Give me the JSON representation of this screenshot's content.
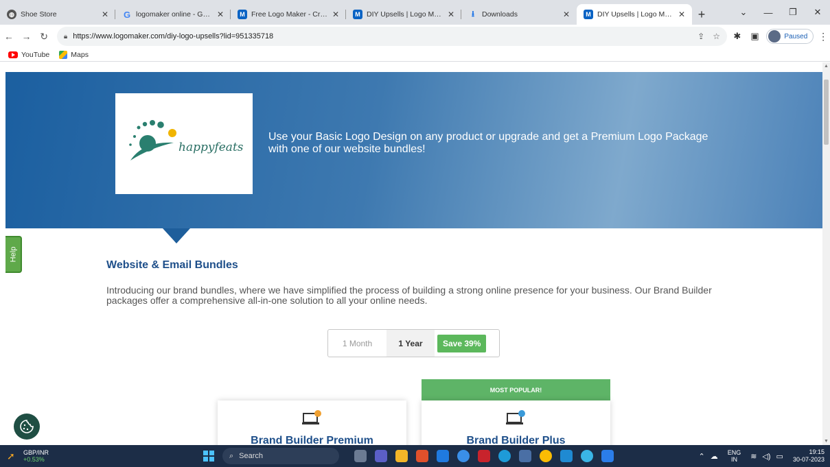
{
  "browser": {
    "tabs": [
      {
        "title": "Shoe Store",
        "icon": "globe-icon",
        "active": false
      },
      {
        "title": "logomaker online - Google",
        "icon": "google-icon",
        "active": false
      },
      {
        "title": "Free Logo Maker - Create a",
        "icon": "logomaker-icon",
        "active": false
      },
      {
        "title": "DIY Upsells | Logo Maker",
        "icon": "logomaker-icon",
        "active": false
      },
      {
        "title": "Downloads",
        "icon": "download-icon",
        "active": false
      },
      {
        "title": "DIY Upsells | Logo Maker",
        "icon": "logomaker-icon",
        "active": true
      }
    ],
    "url": "https://www.logomaker.com/diy-logo-upsells?lid=951335718",
    "profile_label": "Paused",
    "bookmarks": [
      {
        "label": "YouTube",
        "icon": "youtube-icon"
      },
      {
        "label": "Maps",
        "icon": "maps-icon"
      }
    ]
  },
  "hero": {
    "logo_text": "happyfeats",
    "message": "Use your Basic Logo Design on any product or upgrade and get a Premium Logo Package with one of our website bundles!"
  },
  "help_label": "Help",
  "section": {
    "title": "Website & Email Bundles",
    "description": "Introducing our brand bundles, where we have simplified the process of building a strong online presence for your business. Our Brand Builder packages offer a comprehensive all-in-one solution to all your online needs."
  },
  "billing_toggle": {
    "month_label": "1 Month",
    "year_label": "1 Year",
    "save_label": "Save 39%",
    "selected": "1 Year"
  },
  "plans": [
    {
      "name": "Brand Builder Premium",
      "badge": ""
    },
    {
      "name": "Brand Builder Plus",
      "badge": "MOST POPULAR!"
    }
  ],
  "taskbar": {
    "stock_symbol": "GBP/INR",
    "stock_change": "+0.53%",
    "search_placeholder": "Search",
    "lang_line1": "ENG",
    "lang_line2": "IN",
    "time": "19:15",
    "date": "30-07-2023"
  },
  "colors": {
    "accent_blue": "#1e4f8a",
    "popular_green": "#5eb467",
    "save_green": "#5cb85c",
    "help_green": "#5fa94a"
  }
}
